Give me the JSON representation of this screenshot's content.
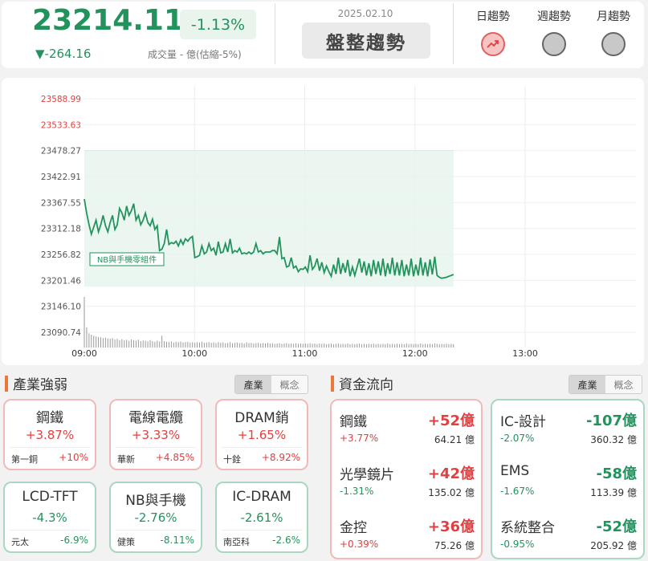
{
  "header": {
    "price": "23214.11",
    "pct": "-1.13%",
    "change": "▼-264.16",
    "volume": "成交量 - 億(估縮-5%)",
    "date": "2025.02.10",
    "trend": "盤整趨勢",
    "trends": [
      {
        "label": "日趨勢",
        "active": true
      },
      {
        "label": "週趨勢",
        "active": false
      },
      {
        "label": "月趨勢",
        "active": false
      }
    ]
  },
  "colors": {
    "up": "#e04040",
    "down": "#23935d",
    "accent": "#e9783a"
  },
  "chart_data": {
    "type": "line",
    "y_ticks": [
      "23588.99",
      "23533.63",
      "23478.27",
      "23422.91",
      "23367.55",
      "23312.18",
      "23256.82",
      "23201.46",
      "23146.10",
      "23090.74"
    ],
    "y_tick_values": [
      23588.99,
      23533.63,
      23478.27,
      23422.91,
      23367.55,
      23312.18,
      23256.82,
      23201.46,
      23146.1,
      23090.74
    ],
    "x_ticks": [
      "09:00",
      "10:00",
      "11:00",
      "12:00",
      "13:00"
    ],
    "ylim": [
      23090.74,
      23588.99
    ],
    "reference_level": 23478.27,
    "annotation": "NB與手機零組件",
    "series": [
      {
        "values": [
          23375,
          23345,
          23320,
          23300,
          23315,
          23330,
          23305,
          23320,
          23340,
          23318,
          23305,
          23325,
          23340,
          23310,
          23320,
          23355,
          23345,
          23330,
          23360,
          23340,
          23350,
          23365,
          23330,
          23340,
          23320,
          23330,
          23345,
          23325,
          23318,
          23332,
          23310,
          23318,
          23265,
          23268,
          23280,
          23310,
          23278,
          23282,
          23280,
          23285,
          23275,
          23288,
          23278,
          23290,
          23285,
          23292,
          23295,
          23250,
          23252,
          23255,
          23275,
          23258,
          23262,
          23280,
          23265,
          23270,
          23255,
          23284,
          23260,
          23262,
          23280,
          23262,
          23290,
          23260,
          23265,
          23262,
          23270,
          23258,
          23260,
          23258,
          23262,
          23258,
          23262,
          23280,
          23262,
          23265,
          23258,
          23262,
          23262,
          23262,
          23265,
          23265,
          23258,
          23294,
          23248,
          23250,
          23230,
          23232,
          23250,
          23228,
          23232,
          23220,
          23226,
          23225,
          23230,
          23220,
          23255,
          23225,
          23232,
          23248,
          23222,
          23240,
          23218,
          23232,
          23220,
          23210,
          23235,
          23215,
          23250,
          23215,
          23238,
          23218,
          23245,
          23210,
          23230,
          23212,
          23230,
          23248,
          23218,
          23242,
          23212,
          23238,
          23210,
          23245,
          23215,
          23242,
          23212,
          23248,
          23210,
          23238,
          23215,
          23250,
          23212,
          23240,
          23212,
          23245,
          23210,
          23235,
          23212,
          23248,
          23210,
          23235,
          23212,
          23250,
          23212,
          23240,
          23210,
          23246,
          23214,
          23252,
          23212,
          23208,
          23206,
          23207,
          23208,
          23210,
          23212,
          23214
        ]
      }
    ],
    "volume_bars": [
      150,
      60,
      42,
      38,
      35,
      33,
      31,
      30,
      28,
      29,
      27,
      26,
      28,
      24,
      26,
      22,
      25,
      21,
      23,
      20,
      24,
      22,
      20,
      23,
      19,
      21,
      20,
      18,
      22,
      19,
      17,
      20,
      18,
      35,
      19,
      17,
      16,
      18,
      15,
      17,
      16,
      18,
      15,
      16,
      17,
      15,
      16,
      14,
      16,
      15,
      17,
      14,
      15,
      16,
      14,
      15,
      13,
      16,
      14,
      15,
      13,
      14,
      16,
      13,
      14,
      15,
      13,
      14,
      12,
      15,
      13,
      14,
      12,
      13,
      14,
      12,
      13,
      12,
      14,
      12,
      13,
      11,
      12,
      13,
      11,
      12,
      13,
      11,
      12,
      11,
      13,
      11,
      12,
      11,
      12,
      11,
      13,
      11,
      12,
      10,
      12,
      11,
      12,
      10,
      11,
      12,
      10,
      11,
      12,
      10,
      11,
      10,
      12,
      10,
      11,
      10,
      11,
      12,
      10,
      11,
      10,
      11,
      10,
      12,
      10,
      11,
      10,
      11,
      10,
      12,
      10,
      11,
      10,
      11,
      10,
      11,
      10,
      12,
      10,
      11,
      10,
      11,
      10,
      12,
      10,
      11,
      10,
      11,
      10,
      12,
      11,
      10,
      11,
      10,
      11,
      10,
      11,
      10
    ]
  },
  "industry": {
    "title": "產業強弱",
    "tabs": [
      "產業",
      "概念"
    ],
    "cards": [
      {
        "name": "鋼鐵",
        "pct": "+3.87%",
        "stock": "第一銅",
        "spct": "+10%",
        "up": true
      },
      {
        "name": "電線電纜",
        "pct": "+3.33%",
        "stock": "華新",
        "spct": "+4.85%",
        "up": true
      },
      {
        "name": "DRAM銷",
        "pct": "+1.65%",
        "stock": "十銓",
        "spct": "+8.92%",
        "up": true
      },
      {
        "name": "LCD-TFT",
        "pct": "-4.3%",
        "stock": "元太",
        "spct": "-6.9%",
        "up": false
      },
      {
        "name": "NB與手機",
        "pct": "-2.76%",
        "stock": "健策",
        "spct": "-8.11%",
        "up": false
      },
      {
        "name": "IC-DRAM",
        "pct": "-2.61%",
        "stock": "南亞科",
        "spct": "-2.6%",
        "up": false
      }
    ]
  },
  "fund_flow": {
    "title": "資金流向",
    "tabs": [
      "產業",
      "概念"
    ],
    "inflow": [
      {
        "name": "鋼鐵",
        "amt": "+52億",
        "pct": "+3.77%",
        "vol": "64.21 億"
      },
      {
        "name": "光學鏡片",
        "amt": "+42億",
        "pct": "-1.31%",
        "vol": "135.02 億"
      },
      {
        "name": "金控",
        "amt": "+36億",
        "pct": "+0.39%",
        "vol": "75.26 億"
      }
    ],
    "outflow": [
      {
        "name": "IC-設計",
        "amt": "-107億",
        "pct": "-2.07%",
        "vol": "360.32 億"
      },
      {
        "name": "EMS",
        "amt": "-58億",
        "pct": "-1.67%",
        "vol": "113.39 億"
      },
      {
        "name": "系統整合",
        "amt": "-52億",
        "pct": "-0.95%",
        "vol": "205.92 億"
      }
    ]
  }
}
